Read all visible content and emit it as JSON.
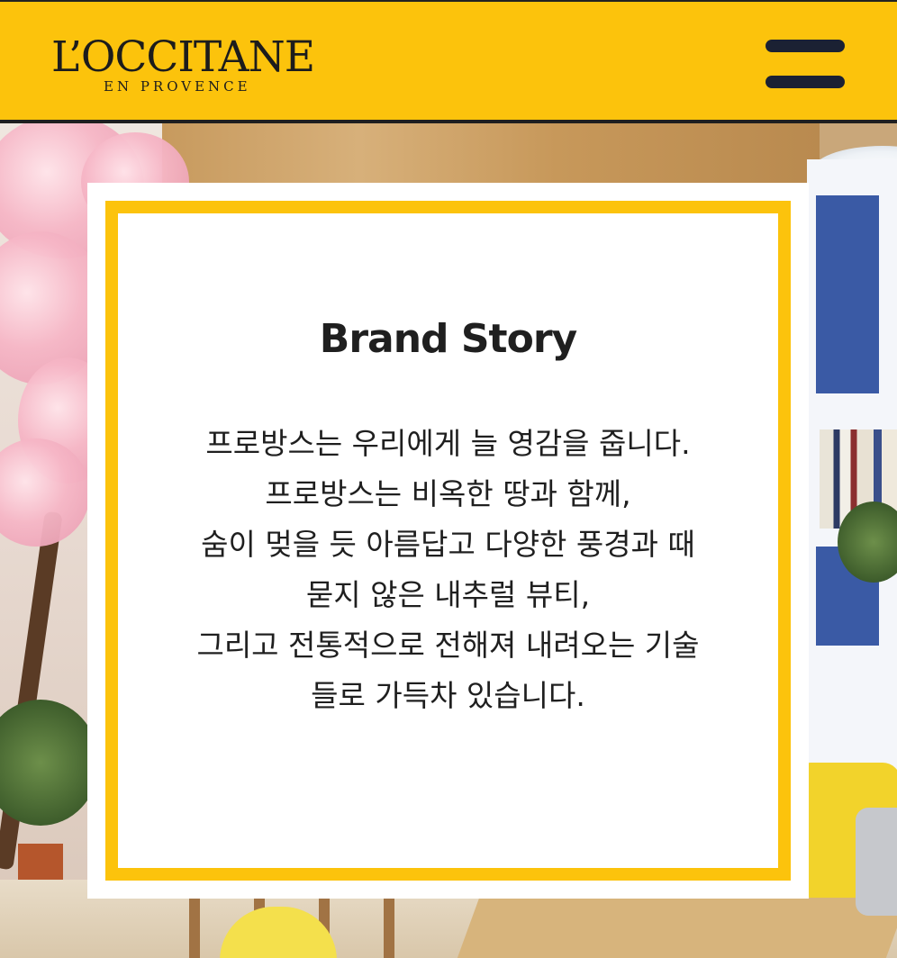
{
  "header": {
    "logo_main": "L’OCCITANE",
    "logo_sub": "EN PROVENCE",
    "menu_icon": "hamburger-menu-icon",
    "background_color": "#fcc30c"
  },
  "brand_story": {
    "title": "Brand Story",
    "body_lines": [
      "프로방스는 우리에게 늘 영감을 줍니다.",
      "프로방스는 비옥한 땅과 함께,",
      "숨이 멎을 듯 아름답고 다양한 풍경과 때묻지 않은 내추럴 뷰티,",
      "그리고 전통적으로 전해져 내려오는 기술들로 가득차 있습니다."
    ],
    "frame_color": "#fcc30c"
  }
}
